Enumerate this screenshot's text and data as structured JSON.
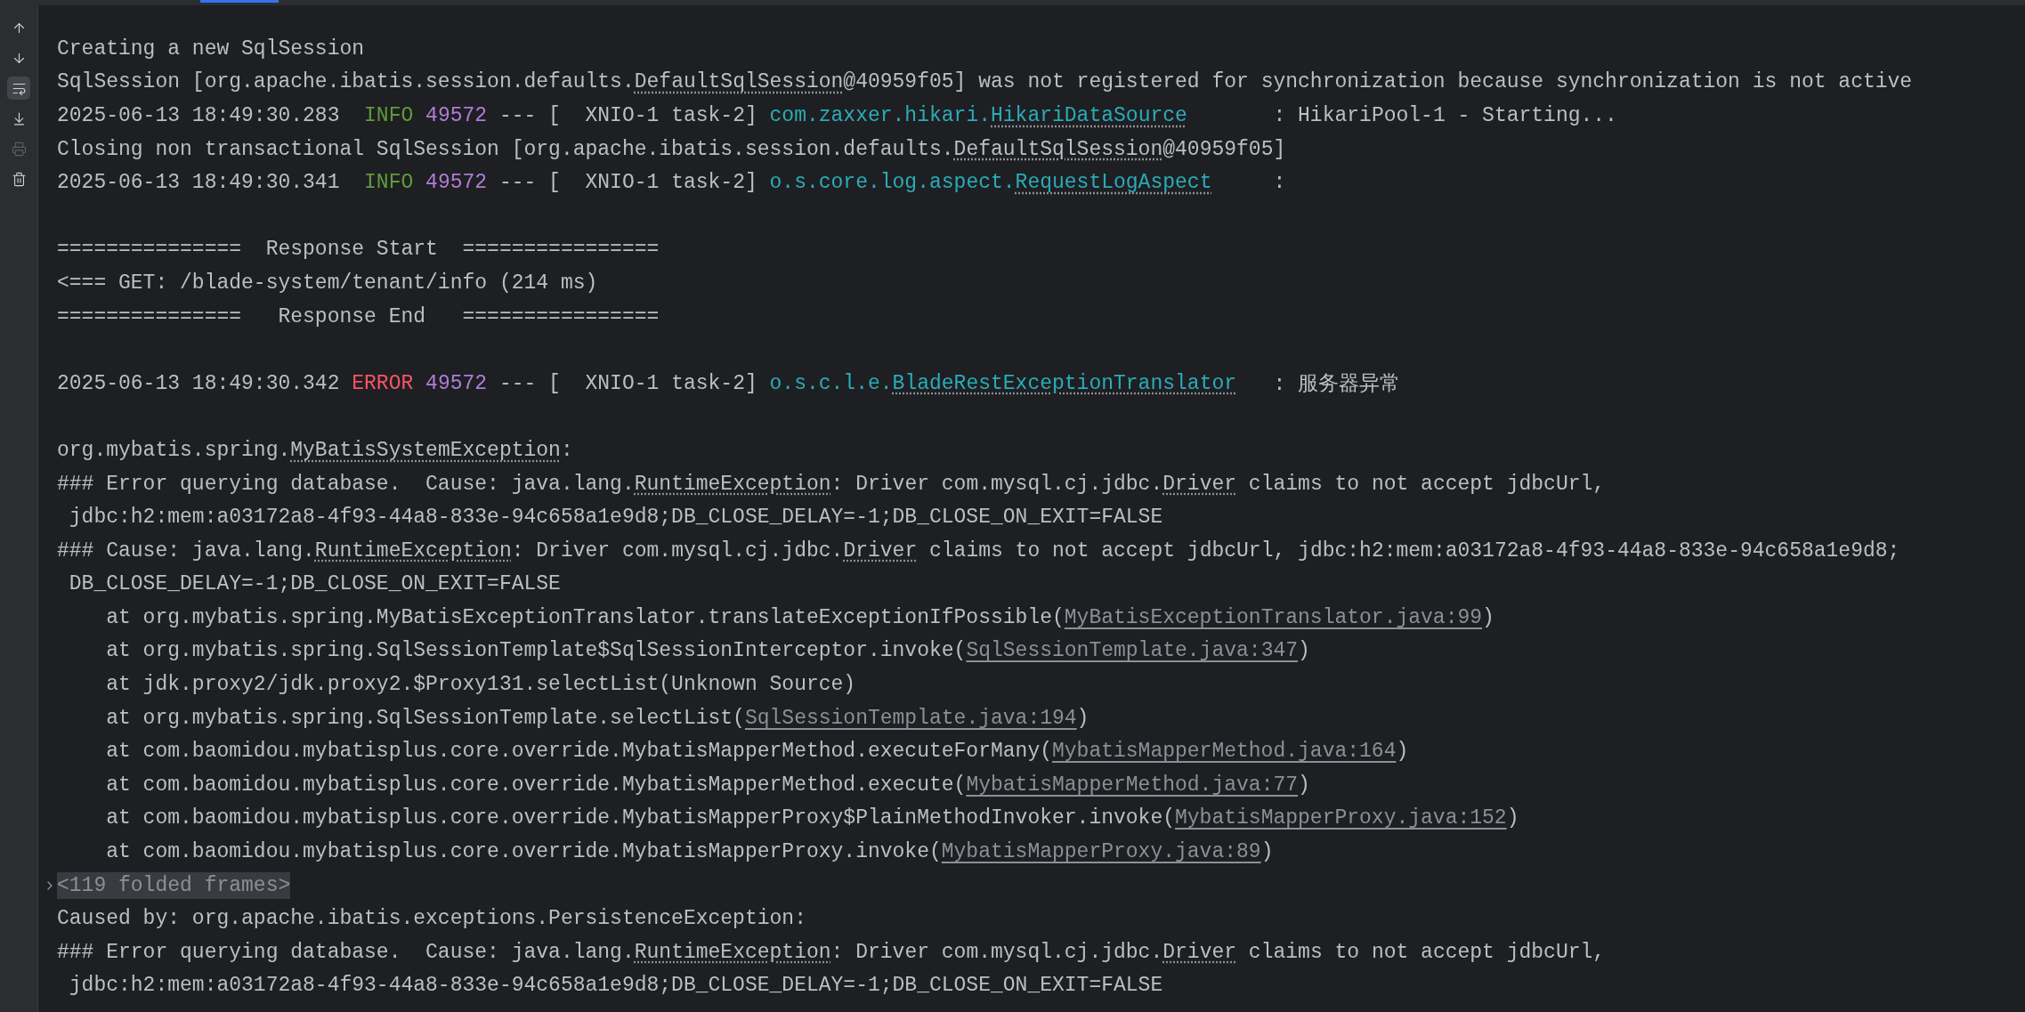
{
  "toolbar": [
    {
      "kind": "up",
      "selected": false,
      "disabled": false
    },
    {
      "kind": "down",
      "selected": false,
      "disabled": false
    },
    {
      "kind": "wrap",
      "selected": true,
      "disabled": false
    },
    {
      "kind": "scroll_end",
      "selected": false,
      "disabled": false
    },
    {
      "kind": "print",
      "selected": false,
      "disabled": true
    },
    {
      "kind": "clear",
      "selected": false,
      "disabled": false
    }
  ],
  "console": [
    {
      "kind": "text",
      "segments": [
        {
          "kind": "text",
          "text": "Creating a new SqlSession"
        }
      ]
    },
    {
      "kind": "text",
      "segments": [
        {
          "kind": "text",
          "text": "SqlSession [org.apache.ibatis.session.defaults."
        },
        {
          "kind": "type_link",
          "text": "DefaultSqlSession"
        },
        {
          "kind": "text",
          "text": "@40959f05] was not registered for synchronization because synchronization is not active"
        }
      ]
    },
    {
      "kind": "text",
      "segments": [
        {
          "kind": "text",
          "text": "2025-06-13 18:49:30.283  "
        },
        {
          "kind": "level_info",
          "text": "INFO"
        },
        {
          "kind": "pid",
          "text": "49572"
        },
        {
          "kind": "text",
          "text": " --- [  XNIO-1 task-2] "
        },
        {
          "kind": "logger",
          "text": "com.zaxxer.hikari."
        },
        {
          "kind": "logger_link",
          "text": "HikariDataSource"
        },
        {
          "kind": "text",
          "text": "       : HikariPool-1 - Starting..."
        }
      ]
    },
    {
      "kind": "text",
      "segments": [
        {
          "kind": "text",
          "text": "Closing non transactional SqlSession [org.apache.ibatis.session.defaults."
        },
        {
          "kind": "type_link",
          "text": "DefaultSqlSession"
        },
        {
          "kind": "text",
          "text": "@40959f05]"
        }
      ]
    },
    {
      "kind": "text",
      "segments": [
        {
          "kind": "text",
          "text": "2025-06-13 18:49:30.341  "
        },
        {
          "kind": "level_info",
          "text": "INFO"
        },
        {
          "kind": "pid",
          "text": "49572"
        },
        {
          "kind": "text",
          "text": " --- [  XNIO-1 task-2] "
        },
        {
          "kind": "logger",
          "text": "o.s.core.log.aspect."
        },
        {
          "kind": "logger_link",
          "text": "RequestLogAspect"
        },
        {
          "kind": "text",
          "text": "     :"
        }
      ]
    },
    {
      "kind": "blank"
    },
    {
      "kind": "text",
      "segments": [
        {
          "kind": "text",
          "text": "===============  Response Start  ================"
        }
      ]
    },
    {
      "kind": "text",
      "segments": [
        {
          "kind": "text",
          "text": "<=== GET: /blade-system/tenant/info (214 ms)"
        }
      ]
    },
    {
      "kind": "text",
      "segments": [
        {
          "kind": "text",
          "text": "===============   Response End   ================"
        }
      ]
    },
    {
      "kind": "blank"
    },
    {
      "kind": "text",
      "segments": [
        {
          "kind": "text",
          "text": "2025-06-13 18:49:30.342 "
        },
        {
          "kind": "level_error",
          "text": "ERROR"
        },
        {
          "kind": "pid",
          "text": "49572"
        },
        {
          "kind": "text",
          "text": " --- [  XNIO-1 task-2] "
        },
        {
          "kind": "logger",
          "text": "o.s.c.l.e."
        },
        {
          "kind": "logger_link",
          "text": "BladeRestExceptionTranslator"
        },
        {
          "kind": "text",
          "text": "   : 服务器异常"
        }
      ]
    },
    {
      "kind": "blank"
    },
    {
      "kind": "text",
      "segments": [
        {
          "kind": "text",
          "text": "org.mybatis.spring."
        },
        {
          "kind": "type_link",
          "text": "MyBatisSystemException"
        },
        {
          "kind": "text",
          "text": ":"
        }
      ]
    },
    {
      "kind": "text",
      "segments": [
        {
          "kind": "text",
          "text": "### Error querying database.  Cause: java.lang."
        },
        {
          "kind": "type_link",
          "text": "RuntimeException"
        },
        {
          "kind": "text",
          "text": ": Driver com.mysql.cj.jdbc."
        },
        {
          "kind": "type_link",
          "text": "Driver"
        },
        {
          "kind": "text",
          "text": " claims to not accept jdbcUrl,"
        }
      ]
    },
    {
      "kind": "text",
      "segments": [
        {
          "kind": "text",
          "text": " jdbc:h2:mem:a03172a8-4f93-44a8-833e-94c658a1e9d8;DB_CLOSE_DELAY=-1;DB_CLOSE_ON_EXIT=FALSE"
        }
      ]
    },
    {
      "kind": "text",
      "segments": [
        {
          "kind": "text",
          "text": "### Cause: java.lang."
        },
        {
          "kind": "type_link",
          "text": "RuntimeException"
        },
        {
          "kind": "text",
          "text": ": Driver com.mysql.cj.jdbc."
        },
        {
          "kind": "type_link",
          "text": "Driver"
        },
        {
          "kind": "text",
          "text": " claims to not accept jdbcUrl, jdbc:h2:mem:a03172a8-4f93-44a8-833e-94c658a1e9d8;"
        }
      ]
    },
    {
      "kind": "text",
      "segments": [
        {
          "kind": "text",
          "text": " DB_CLOSE_DELAY=-1;DB_CLOSE_ON_EXIT=FALSE"
        }
      ]
    },
    {
      "kind": "text",
      "segments": [
        {
          "kind": "text",
          "text": "    at org.mybatis.spring.MyBatisExceptionTranslator.translateExceptionIfPossible("
        },
        {
          "kind": "file_link",
          "text": "MyBatisExceptionTranslator.java:99"
        },
        {
          "kind": "text",
          "text": ")"
        }
      ]
    },
    {
      "kind": "text",
      "segments": [
        {
          "kind": "text",
          "text": "    at org.mybatis.spring.SqlSessionTemplate$SqlSessionInterceptor.invoke("
        },
        {
          "kind": "file_link",
          "text": "SqlSessionTemplate.java:347"
        },
        {
          "kind": "text",
          "text": ")"
        }
      ]
    },
    {
      "kind": "text",
      "segments": [
        {
          "kind": "text",
          "text": "    at jdk.proxy2/jdk.proxy2.$Proxy131.selectList(Unknown Source)"
        }
      ]
    },
    {
      "kind": "text",
      "segments": [
        {
          "kind": "text",
          "text": "    at org.mybatis.spring.SqlSessionTemplate.selectList("
        },
        {
          "kind": "file_link",
          "text": "SqlSessionTemplate.java:194"
        },
        {
          "kind": "text",
          "text": ")"
        }
      ]
    },
    {
      "kind": "text",
      "segments": [
        {
          "kind": "text",
          "text": "    at com.baomidou.mybatisplus.core.override.MybatisMapperMethod.executeForMany("
        },
        {
          "kind": "file_link",
          "text": "MybatisMapperMethod.java:164"
        },
        {
          "kind": "text",
          "text": ")"
        }
      ]
    },
    {
      "kind": "text",
      "segments": [
        {
          "kind": "text",
          "text": "    at com.baomidou.mybatisplus.core.override.MybatisMapperMethod.execute("
        },
        {
          "kind": "file_link",
          "text": "MybatisMapperMethod.java:77"
        },
        {
          "kind": "text",
          "text": ")"
        }
      ]
    },
    {
      "kind": "text",
      "segments": [
        {
          "kind": "text",
          "text": "    at com.baomidou.mybatisplus.core.override.MybatisMapperProxy$PlainMethodInvoker.invoke("
        },
        {
          "kind": "file_link",
          "text": "MybatisMapperProxy.java:152"
        },
        {
          "kind": "text",
          "text": ")"
        }
      ]
    },
    {
      "kind": "text",
      "segments": [
        {
          "kind": "text",
          "text": "    at com.baomidou.mybatisplus.core.override.MybatisMapperProxy.invoke("
        },
        {
          "kind": "file_link",
          "text": "MybatisMapperProxy.java:89"
        },
        {
          "kind": "text",
          "text": ")"
        }
      ]
    },
    {
      "kind": "folded",
      "expanded": false,
      "text": "<119 folded frames>"
    },
    {
      "kind": "text",
      "segments": [
        {
          "kind": "text",
          "text": "Caused by: org.apache.ibatis.exceptions.PersistenceException:"
        }
      ]
    },
    {
      "kind": "text",
      "segments": [
        {
          "kind": "text",
          "text": "### Error querying database.  Cause: java.lang."
        },
        {
          "kind": "type_link",
          "text": "RuntimeException"
        },
        {
          "kind": "text",
          "text": ": Driver com.mysql.cj.jdbc."
        },
        {
          "kind": "type_link",
          "text": "Driver"
        },
        {
          "kind": "text",
          "text": " claims to not accept jdbcUrl,"
        }
      ]
    },
    {
      "kind": "text",
      "segments": [
        {
          "kind": "text",
          "text": " jdbc:h2:mem:a03172a8-4f93-44a8-833e-94c658a1e9d8;DB_CLOSE_DELAY=-1;DB_CLOSE_ON_EXIT=FALSE"
        }
      ]
    }
  ]
}
